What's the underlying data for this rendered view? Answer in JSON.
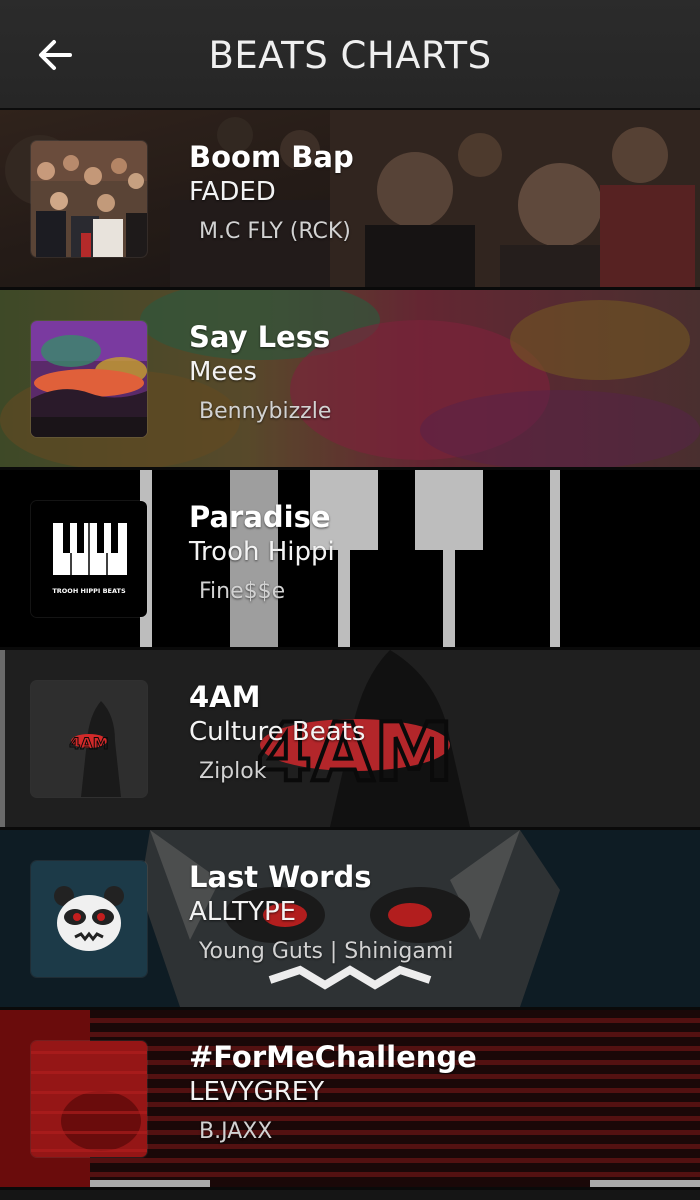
{
  "header": {
    "title": "BEATS CHARTS",
    "back_icon": "arrow-left-icon"
  },
  "beats": [
    {
      "title": "Boom Bap",
      "artist": "FADED",
      "producer": "M.C FLY (RCK)",
      "cover_icon": "mobster-collage-cover",
      "colors": [
        "#3a2a22",
        "#5a4334",
        "#1c1a1a"
      ]
    },
    {
      "title": "Say Less",
      "artist": "Mees",
      "producer": "Bennybizzle",
      "cover_icon": "neon-landscape-cover",
      "colors": [
        "#4a5a2a",
        "#7a2f3a",
        "#6a5a2a"
      ]
    },
    {
      "title": "Paradise",
      "artist": "Trooh Hippi",
      "producer": "Fine$$e",
      "cover_icon": "piano-keys-cover",
      "cover_text": "TROOH HIPPI BEATS",
      "colors": [
        "#000000",
        "#ffffff",
        "#1a1a1a"
      ]
    },
    {
      "title": "4AM",
      "artist": "Culture Beats",
      "producer": "Ziplok",
      "cover_icon": "4am-hooded-figure-cover",
      "colors": [
        "#2a2a2a",
        "#d22a2a",
        "#1a1a1a"
      ]
    },
    {
      "title": "Last Words",
      "artist": "ALLTYPE",
      "producer": "Young Guts | Shinigami",
      "cover_icon": "angry-panda-cover",
      "colors": [
        "#1a3340",
        "#e8e8e8",
        "#b41e1e"
      ]
    },
    {
      "title": "#ForMeChallenge",
      "artist": "LEVYGREY",
      "producer": "B.JAXX",
      "cover_icon": "red-glitch-cover",
      "colors": [
        "#5a0a0a",
        "#a01414",
        "#1a0606"
      ]
    }
  ]
}
